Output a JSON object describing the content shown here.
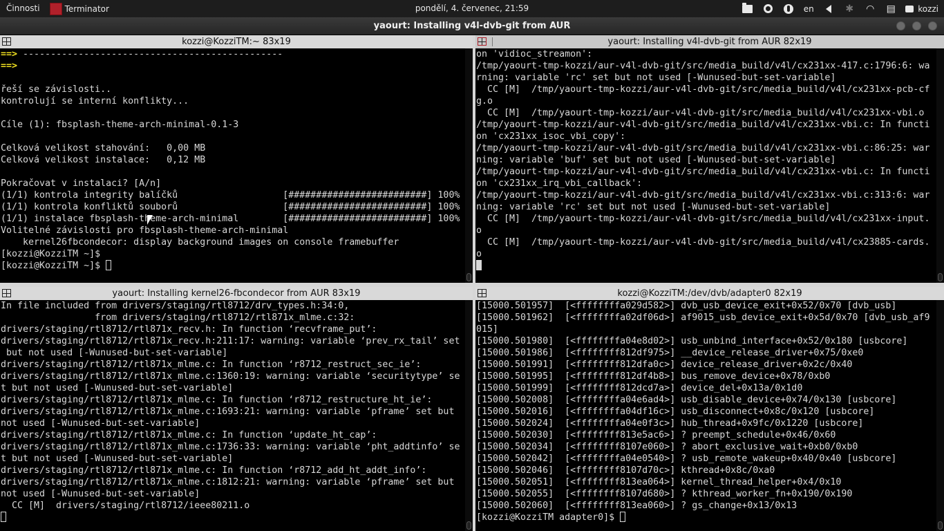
{
  "topbar": {
    "activities": "Činnosti",
    "app_name": "Terminator",
    "clock": "pondělí,  4. červenec, 21:59",
    "lang": "en",
    "user": "kozzi",
    "icons": [
      "folder-icon",
      "disc-icon",
      "accessibility-icon",
      "volume-icon",
      "bluetooth-icon",
      "wifi-icon",
      "clipboard-icon",
      "chat-icon"
    ]
  },
  "window": {
    "title": "yaourt: Installing v4l-dvb-git from AUR"
  },
  "panes": [
    {
      "title": "kozzi@KozziTM:~ 83x19",
      "lines": [
        "==> -----------------------------------------------",
        "==>",
        "",
        "řeší se závislosti..",
        "kontrolují se interní konflikty...",
        "",
        "Cíle (1): fbsplash-theme-arch-minimal-0.1-3",
        "",
        "Celková velikost stahování:   0,00 MB",
        "Celková velikost instalace:   0,12 MB",
        "",
        "Pokračovat v instalaci? [A/n]",
        "(1/1) kontrola integrity balíčků                   [#########################] 100%",
        "(1/1) kontrola konfliktů souborů                   [#########################] 100%",
        "(1/1) instalace fbsplash-theme-arch-minimal        [#########################] 100%",
        "Volitelné závislosti pro fbsplash-theme-arch-minimal",
        "    kernel26fbcondecor: display background images on console framebuffer",
        "[kozzi@KozziTM ~]$",
        "[kozzi@KozziTM ~]$ "
      ]
    },
    {
      "title": "yaourt: Installing v4l-dvb-git from AUR 82x19",
      "lines": [
        "on 'vidioc_streamon':",
        "/tmp/yaourt-tmp-kozzi/aur-v4l-dvb-git/src/media_build/v4l/cx231xx-417.c:1796:6: wa",
        "rning: variable 'rc' set but not used [-Wunused-but-set-variable]",
        "  CC [M]  /tmp/yaourt-tmp-kozzi/aur-v4l-dvb-git/src/media_build/v4l/cx231xx-pcb-cf",
        "g.o",
        "  CC [M]  /tmp/yaourt-tmp-kozzi/aur-v4l-dvb-git/src/media_build/v4l/cx231xx-vbi.o",
        "/tmp/yaourt-tmp-kozzi/aur-v4l-dvb-git/src/media_build/v4l/cx231xx-vbi.c: In functi",
        "on 'cx231xx_isoc_vbi_copy':",
        "/tmp/yaourt-tmp-kozzi/aur-v4l-dvb-git/src/media_build/v4l/cx231xx-vbi.c:86:25: war",
        "ning: variable 'buf' set but not used [-Wunused-but-set-variable]",
        "/tmp/yaourt-tmp-kozzi/aur-v4l-dvb-git/src/media_build/v4l/cx231xx-vbi.c: In functi",
        "on 'cx231xx_irq_vbi_callback':",
        "/tmp/yaourt-tmp-kozzi/aur-v4l-dvb-git/src/media_build/v4l/cx231xx-vbi.c:313:6: war",
        "ning: variable 'rc' set but not used [-Wunused-but-set-variable]",
        "  CC [M]  /tmp/yaourt-tmp-kozzi/aur-v4l-dvb-git/src/media_build/v4l/cx231xx-input.",
        "o",
        "  CC [M]  /tmp/yaourt-tmp-kozzi/aur-v4l-dvb-git/src/media_build/v4l/cx23885-cards.",
        "o",
        ""
      ]
    },
    {
      "title": "yaourt: Installing kernel26-fbcondecor from AUR 83x19",
      "lines": [
        "In file included from drivers/staging/rtl8712/drv_types.h:34:0,",
        "                 from drivers/staging/rtl8712/rtl871x_mlme.c:32:",
        "drivers/staging/rtl8712/rtl871x_recv.h: In function ‘recvframe_put’:",
        "drivers/staging/rtl8712/rtl871x_recv.h:211:17: warning: variable ‘prev_rx_tail’ set",
        " but not used [-Wunused-but-set-variable]",
        "drivers/staging/rtl8712/rtl871x_mlme.c: In function ‘r8712_restruct_sec_ie’:",
        "drivers/staging/rtl8712/rtl871x_mlme.c:1360:19: warning: variable ‘securitytype’ se",
        "t but not used [-Wunused-but-set-variable]",
        "drivers/staging/rtl8712/rtl871x_mlme.c: In function ‘r8712_restructure_ht_ie’:",
        "drivers/staging/rtl8712/rtl871x_mlme.c:1693:21: warning: variable ‘pframe’ set but",
        "not used [-Wunused-but-set-variable]",
        "drivers/staging/rtl8712/rtl871x_mlme.c: In function ‘update_ht_cap’:",
        "drivers/staging/rtl8712/rtl871x_mlme.c:1736:33: warning: variable ‘pht_addtinfo’ se",
        "t but not used [-Wunused-but-set-variable]",
        "drivers/staging/rtl8712/rtl871x_mlme.c: In function ‘r8712_add_ht_addt_info’:",
        "drivers/staging/rtl8712/rtl871x_mlme.c:1812:21: warning: variable ‘pframe’ set but",
        "not used [-Wunused-but-set-variable]",
        "  CC [M]  drivers/staging/rtl8712/ieee80211.o",
        ""
      ]
    },
    {
      "title": "kozzi@KozziTM:/dev/dvb/adapter0 82x19",
      "lines": [
        "[15000.501957]  [<ffffffffa029d582>] dvb_usb_device_exit+0x52/0x70 [dvb_usb]",
        "[15000.501962]  [<ffffffffa02df06d>] af9015_usb_device_exit+0x5d/0x70 [dvb_usb_af9",
        "015]",
        "[15000.501980]  [<ffffffffa04e8d02>] usb_unbind_interface+0x52/0x180 [usbcore]",
        "[15000.501986]  [<ffffffff812df975>] __device_release_driver+0x75/0xe0",
        "[15000.501991]  [<ffffffff812dfa0c>] device_release_driver+0x2c/0x40",
        "[15000.501995]  [<ffffffff812df4b8>] bus_remove_device+0x78/0xb0",
        "[15000.501999]  [<ffffffff812dcd7a>] device_del+0x13a/0x1d0",
        "[15000.502008]  [<ffffffffa04e6ad4>] usb_disable_device+0x74/0x130 [usbcore]",
        "[15000.502016]  [<ffffffffa04df16c>] usb_disconnect+0x8c/0x120 [usbcore]",
        "[15000.502024]  [<ffffffffa04e0f3c>] hub_thread+0x9fc/0x1220 [usbcore]",
        "[15000.502030]  [<ffffffff813e5ac6>] ? preempt_schedule+0x46/0x60",
        "[15000.502034]  [<ffffffff8107e060>] ? abort_exclusive_wait+0xb0/0xb0",
        "[15000.502042]  [<ffffffffa04e0540>] ? usb_remote_wakeup+0x40/0x40 [usbcore]",
        "[15000.502046]  [<ffffffff8107d70c>] kthread+0x8c/0xa0",
        "[15000.502051]  [<ffffffff813ea064>] kernel_thread_helper+0x4/0x10",
        "[15000.502055]  [<ffffffff8107d680>] ? kthread_worker_fn+0x190/0x190",
        "[15000.502060]  [<ffffffff813ea060>] ? gs_change+0x13/0x13",
        "[kozzi@KozziTM adapter0]$ "
      ]
    }
  ]
}
